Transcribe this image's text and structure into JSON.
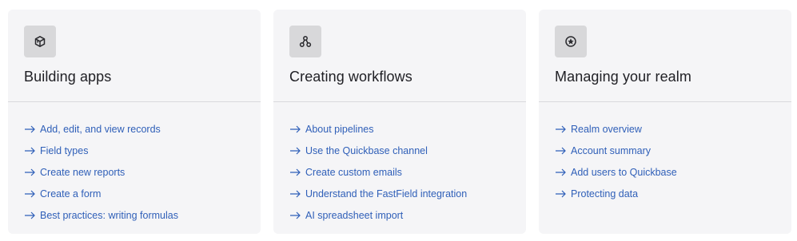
{
  "colors": {
    "link": "#2f5fb8",
    "card_bg": "#f5f5f7",
    "icon_bg": "#d8d8da",
    "title": "#1f1f24"
  },
  "cards": [
    {
      "title": "Building apps",
      "icon": "cube-icon",
      "links": [
        "Add, edit, and view records",
        "Field types",
        "Create new reports",
        "Create a form",
        "Best practices: writing formulas"
      ]
    },
    {
      "title": "Creating workflows",
      "icon": "workflow-nodes-icon",
      "links": [
        "About pipelines",
        "Use the Quickbase channel",
        "Create custom emails",
        "Understand the FastField integration",
        "AI spreadsheet import"
      ]
    },
    {
      "title": "Managing your realm",
      "icon": "star-badge-icon",
      "links": [
        "Realm overview",
        "Account summary",
        "Add users to Quickbase",
        "Protecting data"
      ]
    }
  ]
}
